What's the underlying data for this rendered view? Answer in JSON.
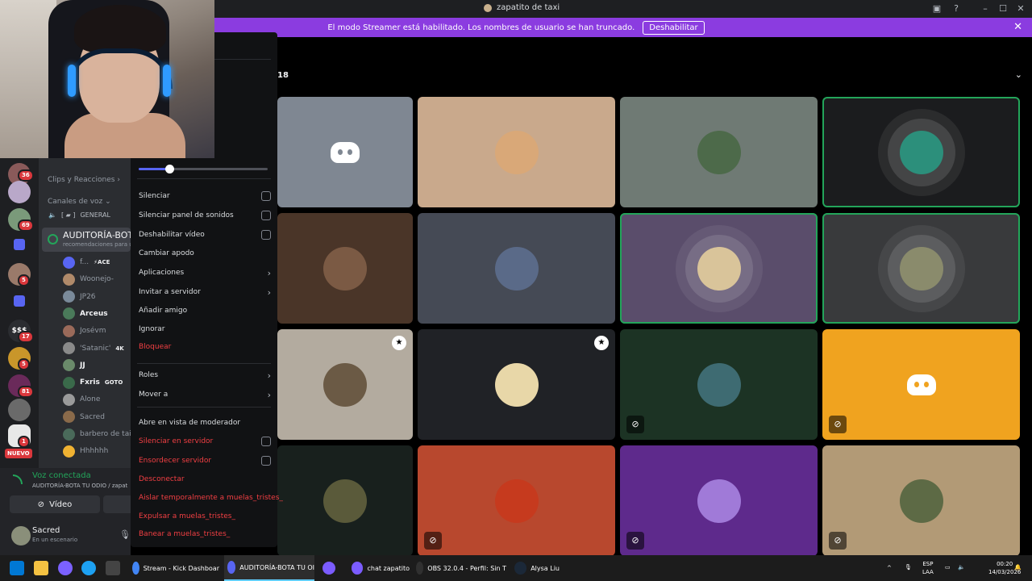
{
  "window": {
    "title": "zapatito de taxi"
  },
  "banner": {
    "text": "El modo Streamer está habilitado. Los nombres de usuario se han truncado.",
    "button": "Deshabilitar"
  },
  "rail": {
    "badges": [
      "36",
      "69",
      "5",
      "17",
      "5",
      "81",
      "1"
    ],
    "new_label": "NUEVO",
    "money_label": "$$$"
  },
  "sidebar": {
    "clips_category": "Clips y Reacciones",
    "voice_category": "Canales de voz",
    "general_channel": "GENERAL",
    "active_channel": "AUDITORÍA-BOTA",
    "active_channel_sub": "recomendaciones para u",
    "voice_users": [
      {
        "name": "f...",
        "tag": "⚡ACE",
        "bold": false
      },
      {
        "name": "Woonejo-",
        "tag": "",
        "bold": false
      },
      {
        "name": "JP26",
        "tag": "",
        "bold": false
      },
      {
        "name": "Arceus",
        "tag": "",
        "bold": true
      },
      {
        "name": "Josévm",
        "tag": "",
        "bold": false
      },
      {
        "name": "'Satanic'",
        "tag": "4K",
        "bold": false
      },
      {
        "name": "JJ",
        "tag": "",
        "bold": true
      },
      {
        "name": "Fxris",
        "tag": "GOTO",
        "bold": true
      },
      {
        "name": "Alone",
        "tag": "",
        "bold": false
      },
      {
        "name": "Sacred",
        "tag": "",
        "bold": false
      },
      {
        "name": "barbero de taig",
        "tag": "",
        "bold": false
      },
      {
        "name": "Hhhhhh",
        "tag": "",
        "bold": false
      }
    ]
  },
  "voice_connected": {
    "status": "Voz conectada",
    "channel": "AUDITORÍA-BOTA TU ODIO / zapat",
    "video_button": "Vídeo"
  },
  "user_panel": {
    "name": "Sacred",
    "status": "En un escenario"
  },
  "context_menu": {
    "items": [
      {
        "label": "Silenciar",
        "type": "checkbox",
        "danger": false
      },
      {
        "label": "Silenciar panel de sonidos",
        "type": "checkbox",
        "danger": false
      },
      {
        "label": "Deshabilitar vídeo",
        "type": "checkbox",
        "danger": false
      },
      {
        "label": "Cambiar apodo",
        "type": "plain",
        "danger": false
      },
      {
        "label": "Aplicaciones",
        "type": "submenu",
        "danger": false
      },
      {
        "label": "Invitar a servidor",
        "type": "submenu",
        "danger": false
      },
      {
        "label": "Añadir amigo",
        "type": "plain",
        "danger": false
      },
      {
        "label": "Ignorar",
        "type": "plain",
        "danger": false
      },
      {
        "label": "Bloquear",
        "type": "plain",
        "danger": true
      },
      {
        "label": "Roles",
        "type": "submenu",
        "danger": false
      },
      {
        "label": "Mover a",
        "type": "submenu",
        "danger": false
      },
      {
        "label": "Abre en vista de moderador",
        "type": "plain",
        "danger": false
      },
      {
        "label": "Silenciar en servidor",
        "type": "checkbox",
        "danger": true
      },
      {
        "label": "Ensordecer servidor",
        "type": "checkbox",
        "danger": true
      },
      {
        "label": "Desconectar",
        "type": "plain",
        "danger": true
      },
      {
        "label": "Aislar temporalmente a muelas_tristes_",
        "type": "plain",
        "danger": true
      },
      {
        "label": "Expulsar a muelas_tristes_",
        "type": "plain",
        "danger": true
      },
      {
        "label": "Banear a muelas_tristes_",
        "type": "plain",
        "danger": true
      }
    ],
    "volume_fraction": 0.24
  },
  "stage": {
    "participant_count": "18",
    "tiles": [
      {
        "bg": "#7f8792",
        "kind": "discord",
        "speaking": false
      },
      {
        "bg": "#c9a98c",
        "kind": "avatar",
        "avatar_color": "#d9a878",
        "speaking": false
      },
      {
        "bg": "#6f7a74",
        "kind": "avatar",
        "avatar_color": "#4d6a4a",
        "speaking": false
      },
      {
        "bg": "#1b1c1e",
        "kind": "ring",
        "avatar_color": "#2c8f7b",
        "speaking": true
      },
      {
        "bg": "#4a3528",
        "kind": "avatar",
        "avatar_color": "#7b5a44",
        "speaking": false
      },
      {
        "bg": "#454a55",
        "kind": "avatar",
        "avatar_color": "#5a6a88",
        "speaking": false
      },
      {
        "bg": "#5a4d6b",
        "kind": "ring",
        "avatar_color": "#d9c49a",
        "speaking": true
      },
      {
        "bg": "#393a3c",
        "kind": "ring",
        "avatar_color": "#8a8b6c",
        "speaking": true
      },
      {
        "bg": "#b3ab9f",
        "kind": "avatar",
        "avatar_color": "#6b5a45",
        "speaking": false,
        "badge": true
      },
      {
        "bg": "#202226",
        "kind": "avatar",
        "avatar_color": "#e8d7a8",
        "speaking": false,
        "badge": true
      },
      {
        "bg": "#1c3324",
        "kind": "avatar",
        "avatar_color": "#3e6b72",
        "speaking": false,
        "muted": true
      },
      {
        "bg": "#f0a31f",
        "kind": "discord",
        "speaking": false,
        "muted": true
      },
      {
        "bg": "#18201d",
        "kind": "avatar",
        "avatar_color": "#5a5a3a",
        "speaking": false
      },
      {
        "bg": "#b8482e",
        "kind": "avatar",
        "avatar_color": "#c63a1e",
        "speaking": false,
        "muted": true
      },
      {
        "bg": "#5e2a8c",
        "kind": "avatar",
        "avatar_color": "#a07ad8",
        "speaking": false,
        "muted": true
      },
      {
        "bg": "#b29a76",
        "kind": "avatar",
        "avatar_color": "#5d6a45",
        "speaking": false,
        "muted": true
      }
    ]
  },
  "taskbar": {
    "apps": [
      {
        "label": "Stream - Kick Dashboar",
        "color": "#4285f4",
        "active": false
      },
      {
        "label": "AUDITORÍA-BOTA TU OI",
        "color": "#5865f2",
        "active": true
      },
      {
        "label": "",
        "color": "#7b5cff",
        "active": false
      },
      {
        "label": "chat zapatito",
        "color": "#7b5cff",
        "active": false
      },
      {
        "label": "OBS 32.0.4 - Perfil: Sin T",
        "color": "#303030",
        "active": false
      },
      {
        "label": "Alysa Liu",
        "color": "#1b2838",
        "active": false
      }
    ],
    "lang_top": "ESP",
    "lang_bottom": "LAA",
    "time": "00:20",
    "date": "14/03/2026"
  }
}
